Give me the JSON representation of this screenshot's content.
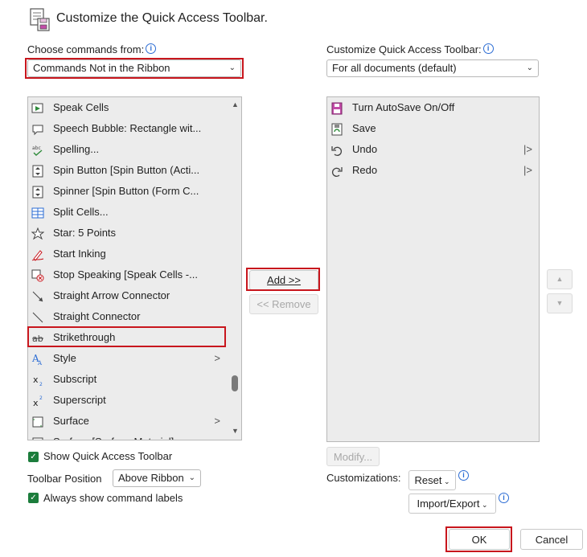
{
  "dialog": {
    "title": "Customize the Quick Access Toolbar."
  },
  "left": {
    "choose_label": "Choose commands from:",
    "choose_value": "Commands Not in the Ribbon",
    "items": [
      {
        "label": "Speak Cells",
        "icon": "speak-cells-icon",
        "submenu": ""
      },
      {
        "label": "Speech Bubble: Rectangle wit...",
        "icon": "speech-bubble-icon",
        "submenu": ""
      },
      {
        "label": "Spelling...",
        "icon": "spelling-icon",
        "submenu": ""
      },
      {
        "label": "Spin Button [Spin Button (Acti...",
        "icon": "spin-button-icon",
        "submenu": ""
      },
      {
        "label": "Spinner [Spin Button (Form C...",
        "icon": "spinner-icon",
        "submenu": ""
      },
      {
        "label": "Split Cells...",
        "icon": "split-cells-icon",
        "submenu": ""
      },
      {
        "label": "Star: 5 Points",
        "icon": "star-icon",
        "submenu": ""
      },
      {
        "label": "Start Inking",
        "icon": "pen-icon",
        "submenu": ""
      },
      {
        "label": "Stop Speaking [Speak Cells -...",
        "icon": "stop-speaking-icon",
        "submenu": ""
      },
      {
        "label": "Straight Arrow Connector",
        "icon": "arrow-connector-icon",
        "submenu": ""
      },
      {
        "label": "Straight Connector",
        "icon": "connector-icon",
        "submenu": ""
      },
      {
        "label": "Strikethrough",
        "icon": "strikethrough-icon",
        "submenu": ""
      },
      {
        "label": "Style",
        "icon": "style-icon",
        "submenu": ">"
      },
      {
        "label": "Subscript",
        "icon": "subscript-icon",
        "submenu": ""
      },
      {
        "label": "Superscript",
        "icon": "superscript-icon",
        "submenu": ""
      },
      {
        "label": "Surface",
        "icon": "surface-icon",
        "submenu": ">"
      },
      {
        "label": "Surface [Surface Material]",
        "icon": "surface-material-icon",
        "submenu": ""
      }
    ]
  },
  "middle": {
    "add_label": "Add >>",
    "remove_label": "<< Remove"
  },
  "right": {
    "customize_label": "Customize Quick Access Toolbar:",
    "customize_value": "For all documents (default)",
    "items": [
      {
        "label": "Turn AutoSave On/Off",
        "icon": "autosave-icon",
        "submenu": ""
      },
      {
        "label": "Save",
        "icon": "save-icon",
        "submenu": ""
      },
      {
        "label": "Undo",
        "icon": "undo-icon",
        "submenu": "|>"
      },
      {
        "label": "Redo",
        "icon": "redo-icon",
        "submenu": "|>"
      }
    ],
    "modify_label": "Modify...",
    "customizations_label": "Customizations:",
    "reset_label": "Reset",
    "import_export_label": "Import/Export"
  },
  "options": {
    "show_qat_label": "Show Quick Access Toolbar",
    "position_label": "Toolbar Position",
    "position_value": "Above Ribbon",
    "always_show_label": "Always show command labels"
  },
  "footer": {
    "ok_label": "OK",
    "cancel_label": "Cancel"
  },
  "colors": {
    "highlight_red": "#c8161d",
    "check_green": "#1c7d3c",
    "info_blue": "#2b6cd4"
  }
}
